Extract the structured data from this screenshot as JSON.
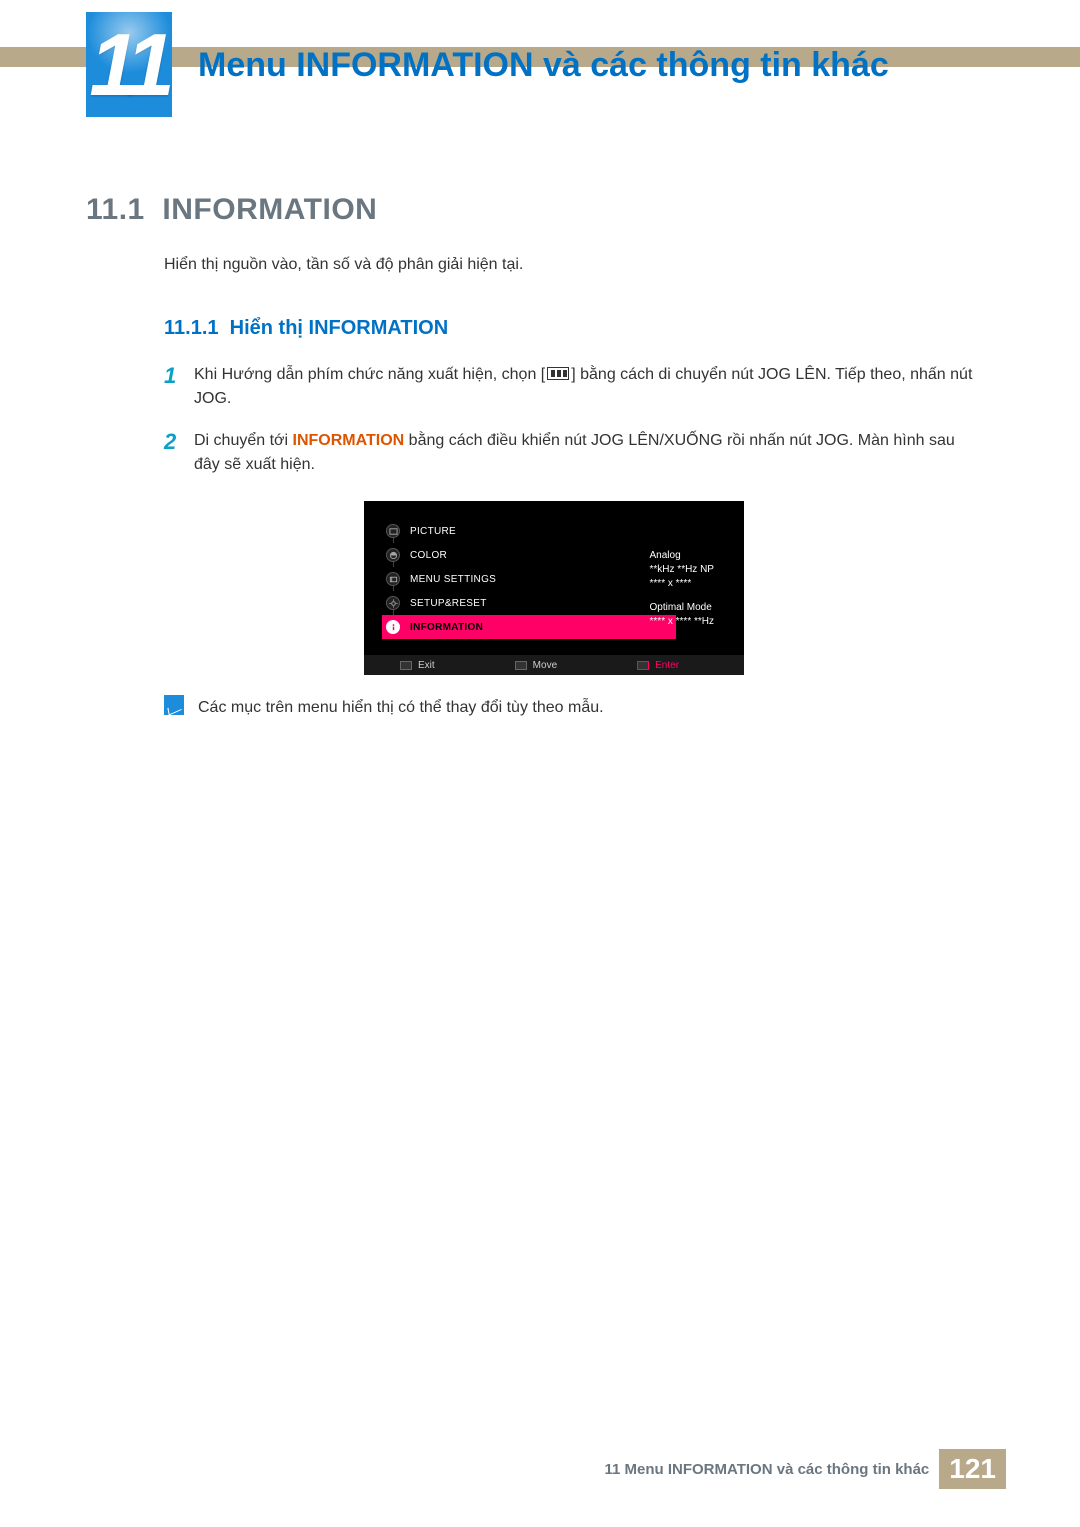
{
  "chapter": {
    "number": "11",
    "title": "Menu INFORMATION và các thông tin khác"
  },
  "section": {
    "number": "11.1",
    "title": "INFORMATION",
    "intro": "Hiển thị nguồn vào, tần số và độ phân giải hiện tại."
  },
  "subsection": {
    "number": "11.1.1",
    "title": "Hiển thị INFORMATION"
  },
  "steps": [
    {
      "n": "1",
      "before": "Khi Hướng dẫn phím chức năng xuất hiện, chọn [",
      "after": "] bằng cách di chuyển nút JOG LÊN. Tiếp theo, nhấn nút JOG."
    },
    {
      "n": "2",
      "before": "Di chuyển tới ",
      "bold": "INFORMATION",
      "after": " bằng cách điều khiển nút JOG LÊN/XUỐNG rồi nhấn nút JOG. Màn hình sau đây sẽ xuất hiện."
    }
  ],
  "osd": {
    "menu": [
      {
        "label": "PICTURE"
      },
      {
        "label": "COLOR"
      },
      {
        "label": "MENU SETTINGS"
      },
      {
        "label": "SETUP&RESET"
      },
      {
        "label": "INFORMATION",
        "selected": true
      }
    ],
    "info": {
      "line1": "Analog",
      "line2": "**kHz **Hz NP",
      "line3": "**** x ****",
      "line4": "Optimal Mode",
      "line5": "**** x **** **Hz"
    },
    "footer": {
      "exit": "Exit",
      "move": "Move",
      "enter": "Enter"
    }
  },
  "note": "Các mục trên menu hiển thị có thể thay đổi tùy theo mẫu.",
  "footer": {
    "text": "11 Menu INFORMATION và các thông tin khác",
    "page": "121"
  }
}
